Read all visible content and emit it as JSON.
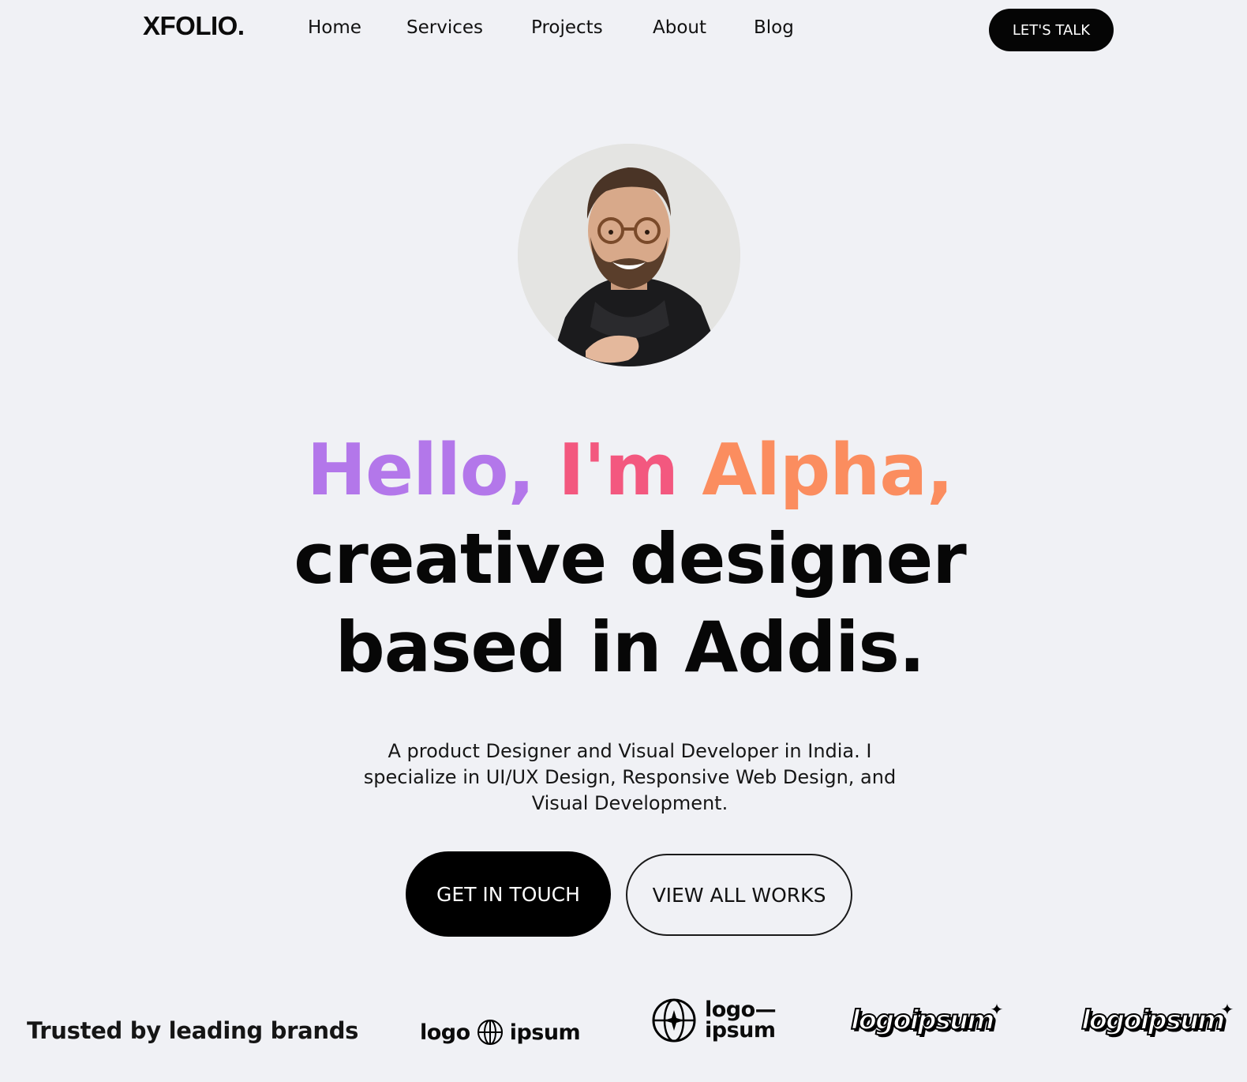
{
  "nav": {
    "logo": "XFOLIO.",
    "links": [
      "Home",
      "Services",
      "Projects",
      "About",
      "Blog"
    ],
    "cta": "LET'S TALK"
  },
  "hero": {
    "greeting": {
      "hello": "Hello,",
      "im": "I'm",
      "name": "Alpha,"
    },
    "line2": "creative designer",
    "line3": "based in Addis.",
    "description": "A product Designer and Visual Developer in India. I specialize in UI/UX Design, Responsive Web Design, and Visual Development.",
    "primary_button": "GET IN TOUCH",
    "secondary_button": "VIEW ALL WORKS"
  },
  "brands": {
    "heading": "Trusted by leading brands",
    "logos": [
      {
        "left": "logo",
        "right": "ipsum"
      },
      {
        "top": "logo—",
        "bottom": "ipsum"
      },
      {
        "text": "logoipsum"
      },
      {
        "text": "logoipsum"
      }
    ]
  },
  "colors": {
    "background": "#f0f1f5",
    "primary": "#000000",
    "gradient": [
      "#b377ea",
      "#f3587f",
      "#fbaa52"
    ]
  }
}
